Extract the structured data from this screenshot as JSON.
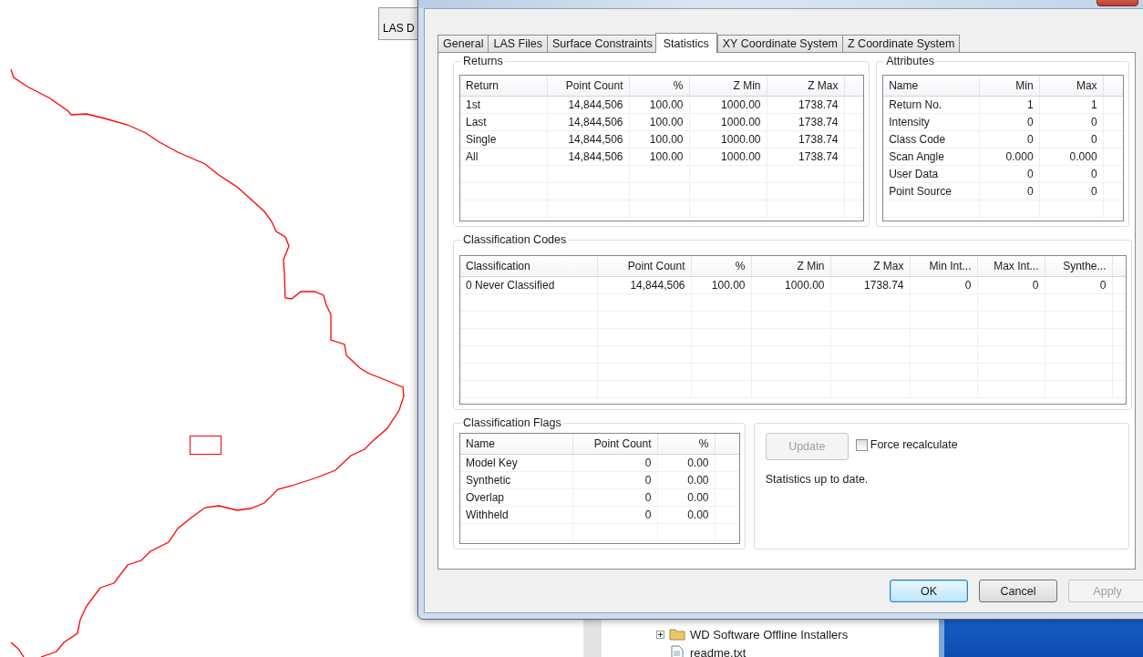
{
  "background_window": {
    "button": "LAS D"
  },
  "explorer": {
    "items": [
      {
        "kind": "folder",
        "label": "WD Software Offline Installers",
        "expanded": false
      },
      {
        "kind": "file",
        "label": "readme.txt"
      }
    ]
  },
  "dialog": {
    "tabs": [
      {
        "label": "General",
        "selected": false
      },
      {
        "label": "LAS Files",
        "selected": false
      },
      {
        "label": "Surface Constraints",
        "selected": false
      },
      {
        "label": "Statistics",
        "selected": true
      },
      {
        "label": "XY Coordinate System",
        "selected": false
      },
      {
        "label": "Z Coordinate System",
        "selected": false
      }
    ],
    "returns": {
      "title": "Returns",
      "columns": [
        "Return",
        "Point Count",
        "%",
        "Z Min",
        "Z Max"
      ],
      "rows": [
        [
          "1st",
          "14,844,506",
          "100.00",
          "1000.00",
          "1738.74"
        ],
        [
          "Last",
          "14,844,506",
          "100.00",
          "1000.00",
          "1738.74"
        ],
        [
          "Single",
          "14,844,506",
          "100.00",
          "1000.00",
          "1738.74"
        ],
        [
          "All",
          "14,844,506",
          "100.00",
          "1000.00",
          "1738.74"
        ]
      ]
    },
    "attributes": {
      "title": "Attributes",
      "columns": [
        "Name",
        "Min",
        "Max"
      ],
      "rows": [
        [
          "Return No.",
          "1",
          "1"
        ],
        [
          "Intensity",
          "0",
          "0"
        ],
        [
          "Class Code",
          "0",
          "0"
        ],
        [
          "Scan Angle",
          "0.000",
          "0.000"
        ],
        [
          "User Data",
          "0",
          "0"
        ],
        [
          "Point Source",
          "0",
          "0"
        ]
      ]
    },
    "classification_codes": {
      "title": "Classification Codes",
      "columns": [
        "Classification",
        "Point Count",
        "%",
        "Z Min",
        "Z Max",
        "Min Int...",
        "Max Int...",
        "Synthe..."
      ],
      "rows": [
        [
          "0  Never Classified",
          "14,844,506",
          "100.00",
          "1000.00",
          "1738.74",
          "0",
          "0",
          "0"
        ]
      ]
    },
    "classification_flags": {
      "title": "Classification Flags",
      "columns": [
        "Name",
        "Point Count",
        "%"
      ],
      "rows": [
        [
          "Model Key",
          "0",
          "0.00"
        ],
        [
          "Synthetic",
          "0",
          "0.00"
        ],
        [
          "Overlap",
          "0",
          "0.00"
        ],
        [
          "Withheld",
          "0",
          "0.00"
        ]
      ]
    },
    "update_button": {
      "label": "Update",
      "disabled": true
    },
    "force_recalculate": {
      "label": "Force recalculate",
      "checked": false
    },
    "status": "Statistics up to date.",
    "buttons": [
      {
        "label": "OK",
        "default": true,
        "disabled": false
      },
      {
        "label": "Cancel",
        "default": false,
        "disabled": false
      },
      {
        "label": "Apply",
        "default": false,
        "disabled": true
      }
    ]
  }
}
